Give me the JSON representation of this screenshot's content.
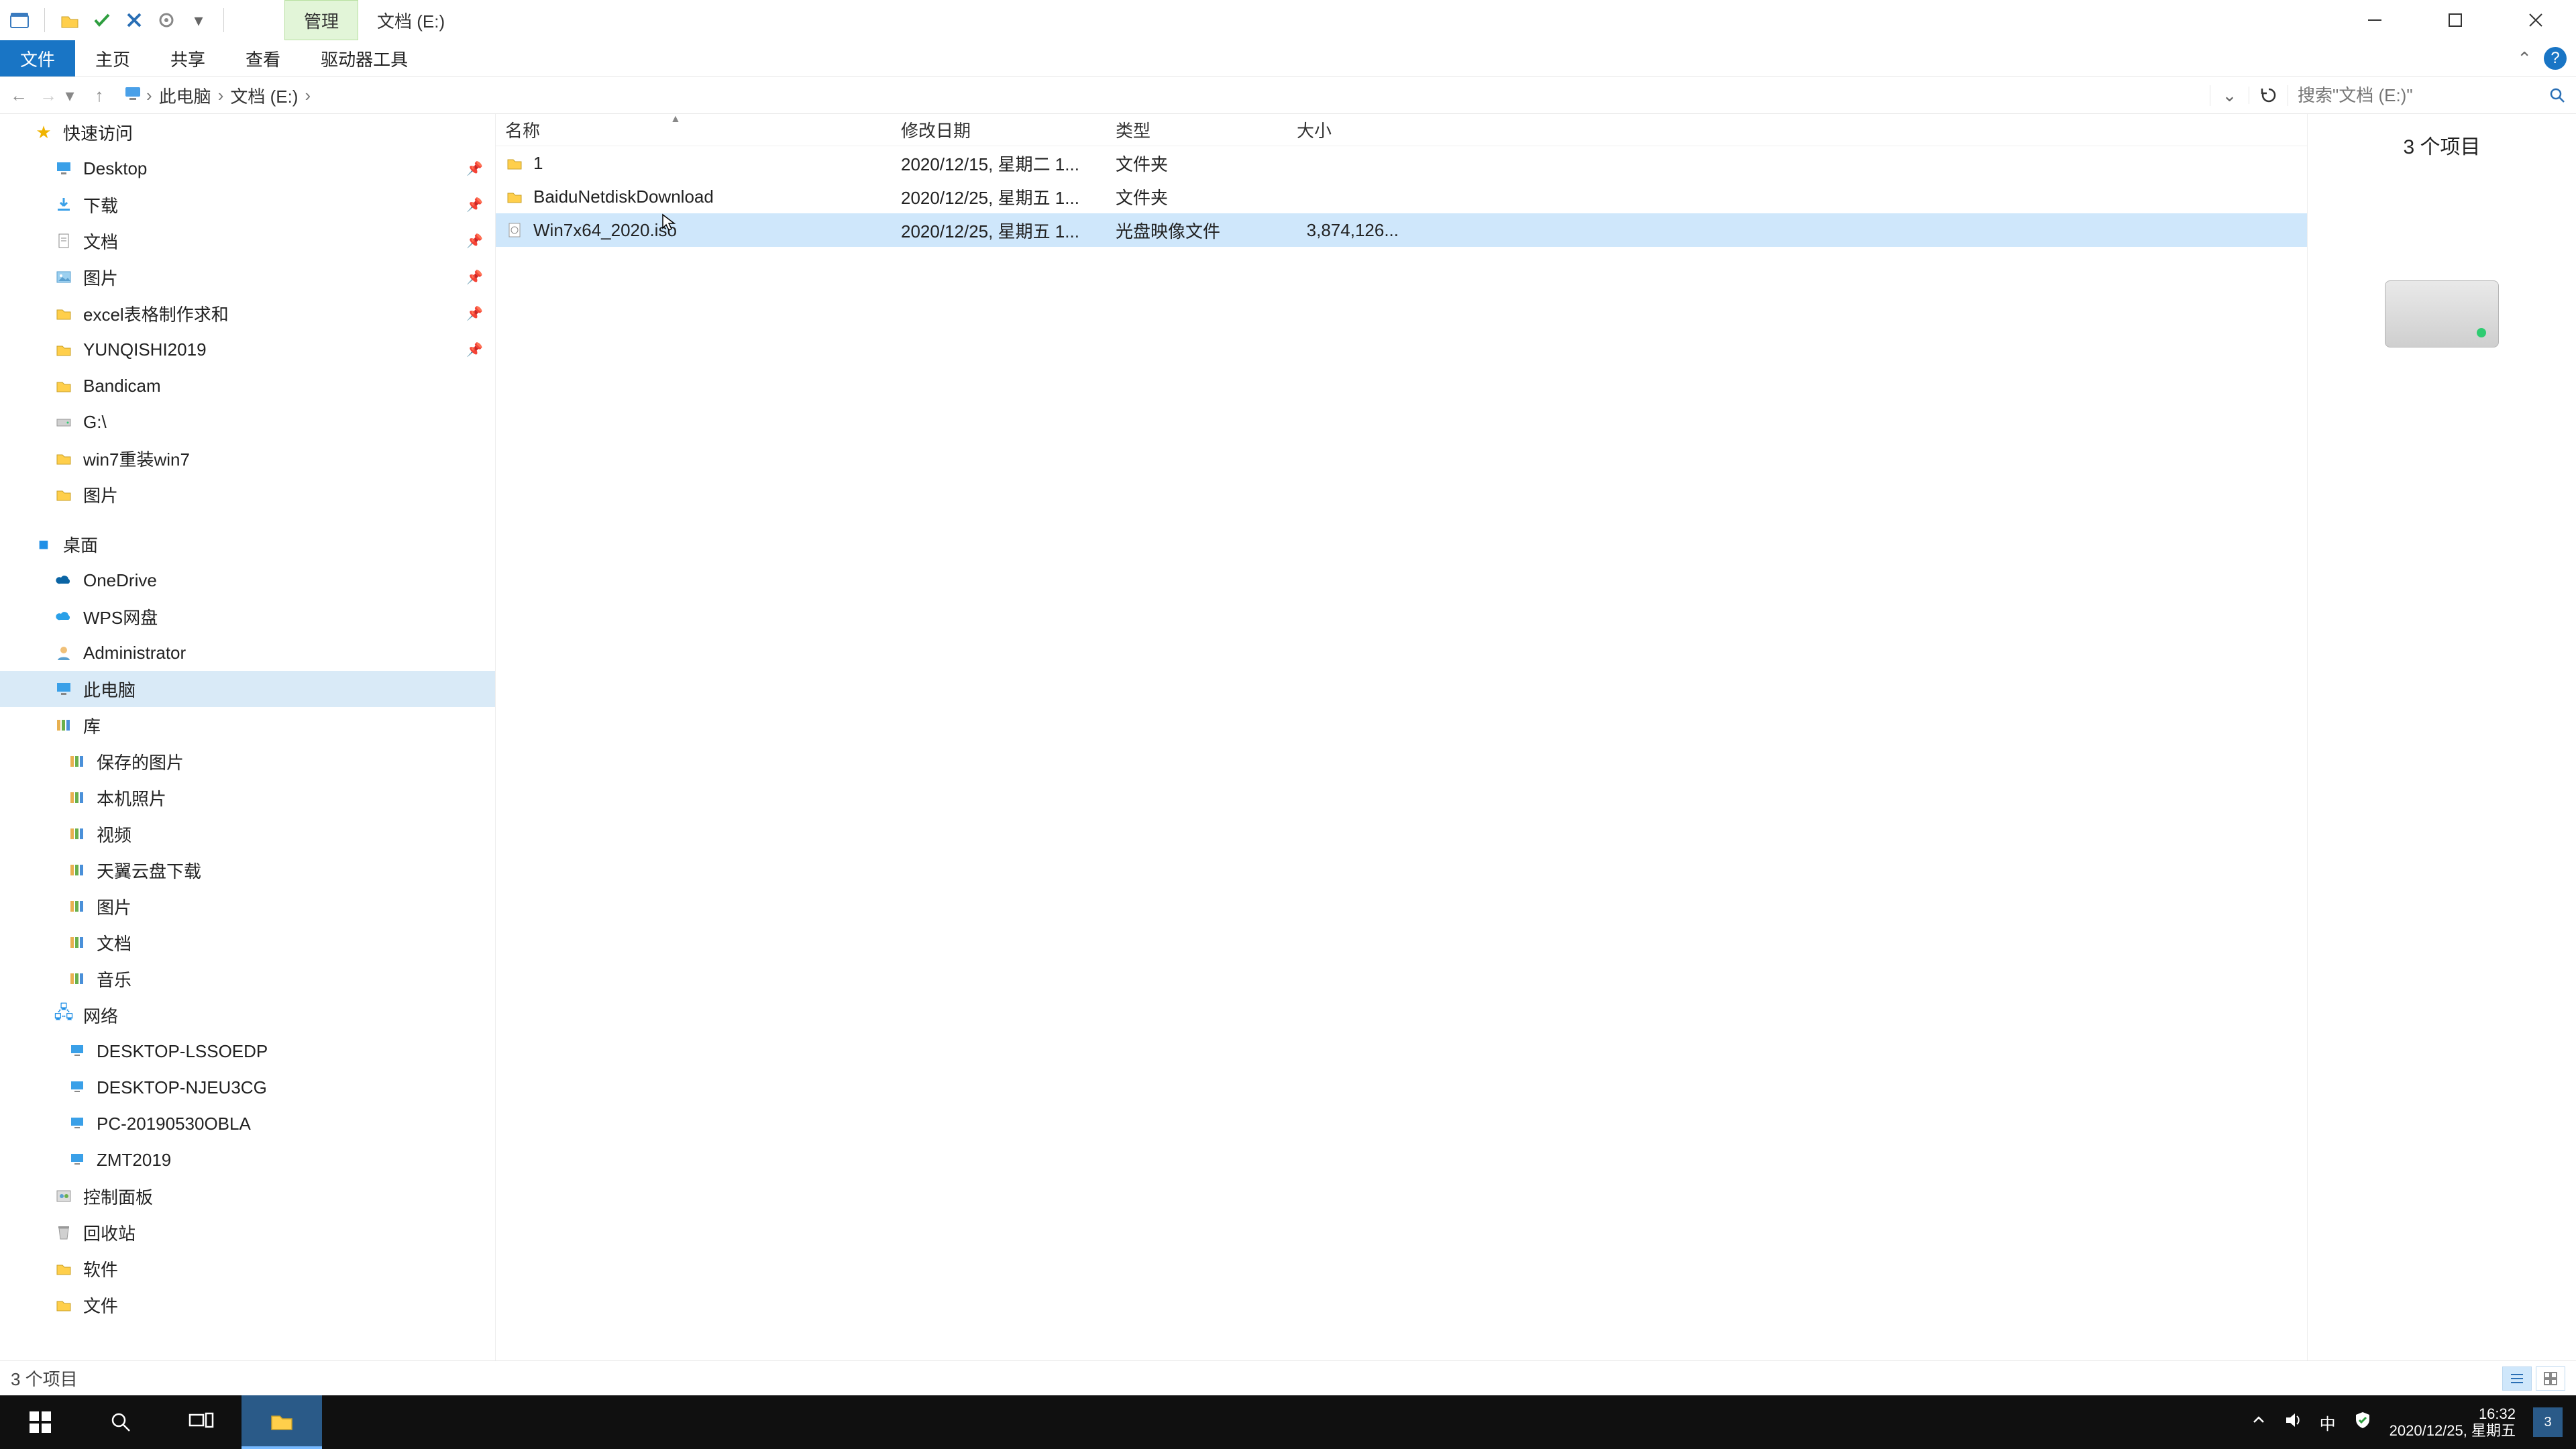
{
  "title_bar": {
    "ribbon_context_tab": "管理",
    "location": "文档 (E:)"
  },
  "ribbon": {
    "file": "文件",
    "tabs": [
      "主页",
      "共享",
      "查看",
      "驱动器工具"
    ]
  },
  "address": {
    "crumbs": [
      "此电脑",
      "文档 (E:)"
    ],
    "search_placeholder": "搜索\"文档 (E:)\""
  },
  "nav_pane": {
    "quick_access": "快速访问",
    "quick_items": [
      {
        "label": "Desktop",
        "icon": "desktop"
      },
      {
        "label": "下载",
        "icon": "download"
      },
      {
        "label": "文档",
        "icon": "doc"
      },
      {
        "label": "图片",
        "icon": "pic"
      },
      {
        "label": "excel表格制作求和",
        "icon": "folder"
      },
      {
        "label": "YUNQISHI2019",
        "icon": "folder"
      },
      {
        "label": "Bandicam",
        "icon": "folder"
      },
      {
        "label": "G:\\",
        "icon": "drive"
      },
      {
        "label": "win7重装win7",
        "icon": "folder"
      },
      {
        "label": "图片",
        "icon": "folder"
      }
    ],
    "desktop_root": "桌面",
    "desktop_items": [
      {
        "label": "OneDrive",
        "icon": "cloud",
        "color": "#0a64a4"
      },
      {
        "label": "WPS网盘",
        "icon": "cloud",
        "color": "#2aa0e8"
      },
      {
        "label": "Administrator",
        "icon": "user"
      },
      {
        "label": "此电脑",
        "icon": "pc",
        "selected": true
      },
      {
        "label": "库",
        "icon": "lib"
      }
    ],
    "library_items": [
      {
        "label": "保存的图片"
      },
      {
        "label": "本机照片"
      },
      {
        "label": "视频"
      },
      {
        "label": "天翼云盘下载"
      },
      {
        "label": "图片"
      },
      {
        "label": "文档"
      },
      {
        "label": "音乐"
      }
    ],
    "network_root": "网络",
    "network_items": [
      {
        "label": "DESKTOP-LSSOEDP"
      },
      {
        "label": "DESKTOP-NJEU3CG"
      },
      {
        "label": "PC-20190530OBLA"
      },
      {
        "label": "ZMT2019"
      }
    ],
    "tail_items": [
      {
        "label": "控制面板",
        "icon": "cp"
      },
      {
        "label": "回收站",
        "icon": "bin"
      },
      {
        "label": "软件",
        "icon": "folder"
      },
      {
        "label": "文件",
        "icon": "folder"
      }
    ]
  },
  "columns": {
    "name": "名称",
    "date": "修改日期",
    "type": "类型",
    "size": "大小"
  },
  "files": [
    {
      "name": "1",
      "date": "2020/12/15, 星期二 1...",
      "type": "文件夹",
      "size": "",
      "icon": "folder"
    },
    {
      "name": "BaiduNetdiskDownload",
      "date": "2020/12/25, 星期五 1...",
      "type": "文件夹",
      "size": "",
      "icon": "folder"
    },
    {
      "name": "Win7x64_2020.iso",
      "date": "2020/12/25, 星期五 1...",
      "type": "光盘映像文件",
      "size": "3,874,126...",
      "icon": "file",
      "selected": true
    }
  ],
  "preview": {
    "item_count_label": "3 个项目"
  },
  "status_bar": {
    "text": "3 个项目"
  },
  "taskbar": {
    "tray": {
      "ime": "中"
    },
    "clock": {
      "time": "16:32",
      "date": "2020/12/25, 星期五"
    },
    "notification_badge": "3"
  }
}
